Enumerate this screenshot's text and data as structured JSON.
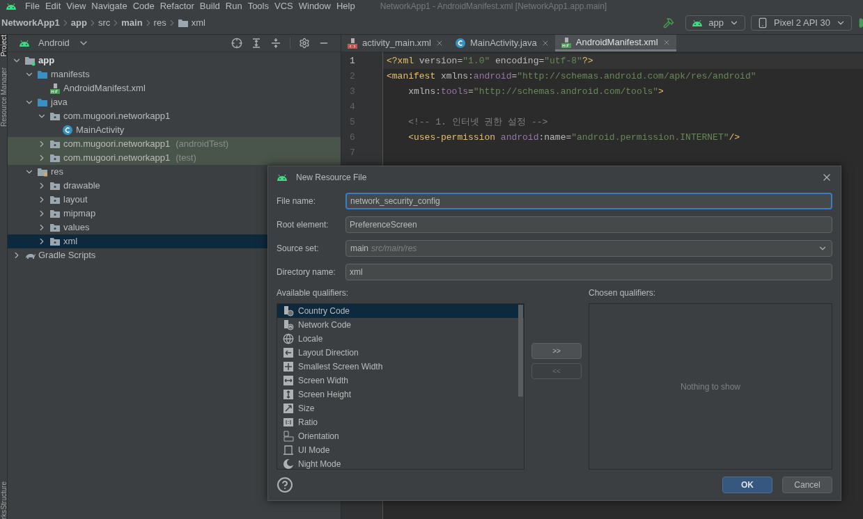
{
  "menu_bar": {
    "items": [
      "File",
      "Edit",
      "View",
      "Navigate",
      "Code",
      "Refactor",
      "Build",
      "Run",
      "Tools",
      "VCS",
      "Window",
      "Help"
    ],
    "title": "NetworkApp1 - AndroidManifest.xml [NetworkApp1.app.main]"
  },
  "breadcrumb": [
    {
      "label": "NetworkApp1",
      "bold": true
    },
    {
      "label": "app",
      "bold": true
    },
    {
      "label": "src",
      "bold": false
    },
    {
      "label": "main",
      "bold": true
    },
    {
      "label": "res",
      "bold": false
    },
    {
      "label": "xml",
      "bold": false,
      "folder": true
    }
  ],
  "run_toolbar": {
    "module": "app",
    "device": "Pixel 2 API 30"
  },
  "side_stripe": [
    {
      "label": "Project",
      "selected": true
    },
    {
      "label": "Resource Manager",
      "selected": false
    },
    {
      "label": "Structure",
      "selected": false
    },
    {
      "label": "rks",
      "selected": false
    }
  ],
  "project_panel": {
    "view": "Android",
    "tree": [
      {
        "label": "app",
        "kind": "module",
        "expanded": true,
        "children": [
          {
            "label": "manifests",
            "kind": "folder",
            "expanded": true,
            "children": [
              {
                "label": "AndroidManifest.xml",
                "kind": "manifest"
              }
            ]
          },
          {
            "label": "java",
            "kind": "folder",
            "expanded": true,
            "children": [
              {
                "label": "com.mugoori.networkapp1",
                "kind": "package",
                "expanded": true,
                "children": [
                  {
                    "label": "MainActivity",
                    "kind": "class"
                  }
                ]
              },
              {
                "label": "com.mugoori.networkapp1",
                "suffix": "(androidTest)",
                "kind": "package",
                "test": true,
                "expanded": false
              },
              {
                "label": "com.mugoori.networkapp1",
                "suffix": "(test)",
                "kind": "package",
                "test": true,
                "expanded": false
              }
            ]
          },
          {
            "label": "res",
            "kind": "resources",
            "expanded": true,
            "children": [
              {
                "label": "drawable",
                "kind": "package",
                "expanded": false
              },
              {
                "label": "layout",
                "kind": "package",
                "expanded": false
              },
              {
                "label": "mipmap",
                "kind": "package",
                "expanded": false
              },
              {
                "label": "values",
                "kind": "package",
                "expanded": false
              },
              {
                "label": "xml",
                "kind": "package",
                "expanded": false,
                "selected": true
              }
            ]
          }
        ]
      },
      {
        "label": "Gradle Scripts",
        "kind": "gradle",
        "expanded": false
      }
    ]
  },
  "editor_tabs": [
    {
      "label": "activity_main.xml",
      "kind": "layout",
      "selected": false
    },
    {
      "label": "MainActivity.java",
      "kind": "class",
      "selected": false
    },
    {
      "label": "AndroidManifest.xml",
      "kind": "manifest",
      "selected": true
    }
  ],
  "code_lines": [
    {
      "number": "1",
      "current": true,
      "segments": [
        {
          "kind": "tag",
          "text": "<?xml "
        },
        {
          "kind": "plain",
          "text": "version="
        },
        {
          "kind": "value",
          "text": "\"1.0\""
        },
        {
          "kind": "plain",
          "text": " encoding="
        },
        {
          "kind": "value",
          "text": "\"utf-8\""
        },
        {
          "kind": "tag",
          "text": "?>"
        }
      ]
    },
    {
      "number": "2",
      "current": false,
      "segments": [
        {
          "kind": "tag",
          "text": "<manifest "
        },
        {
          "kind": "plain",
          "text": "xmlns:"
        },
        {
          "kind": "ns",
          "text": "android"
        },
        {
          "kind": "plain",
          "text": "="
        },
        {
          "kind": "value",
          "text": "\"http://schemas.android.com/apk/res/android\""
        }
      ]
    },
    {
      "number": "3",
      "current": false,
      "segments": [
        {
          "kind": "plain",
          "text": "    xmlns:"
        },
        {
          "kind": "ns",
          "text": "tools"
        },
        {
          "kind": "plain",
          "text": "="
        },
        {
          "kind": "value",
          "text": "\"http://schemas.android.com/tools\""
        },
        {
          "kind": "tag",
          "text": ">"
        }
      ]
    },
    {
      "number": "4",
      "current": false
    },
    {
      "number": "5",
      "current": false,
      "segments": [
        {
          "kind": "comment",
          "text": "    <!-- 1. 인터넷 권한 설정 -->"
        }
      ]
    },
    {
      "number": "6",
      "current": false,
      "segments": [
        {
          "kind": "tag",
          "text": "    <uses-permission "
        },
        {
          "kind": "ns",
          "text": "android"
        },
        {
          "kind": "plain",
          "text": ":name="
        },
        {
          "kind": "value",
          "text": "\"android.permission.INTERNET\""
        },
        {
          "kind": "tag",
          "text": "/>"
        }
      ]
    },
    {
      "number": "7",
      "current": false
    }
  ],
  "dialog": {
    "title": "New Resource File",
    "fields": [
      {
        "label": "File name:",
        "kind": "text",
        "value": "network_security_config",
        "focused": true
      },
      {
        "label": "Root element:",
        "kind": "text",
        "value": "PreferenceScreen",
        "focused": false
      },
      {
        "label": "Source set:",
        "kind": "dropdown",
        "value": "main",
        "hint": "src/main/res",
        "focused": false
      },
      {
        "label": "Directory name:",
        "kind": "text",
        "value": "xml",
        "focused": false
      }
    ],
    "available_label": "Available qualifiers:",
    "qualifiers": [
      {
        "label": "Country Code",
        "kind": "country",
        "selected": true
      },
      {
        "label": "Network Code",
        "kind": "network",
        "selected": false
      },
      {
        "label": "Locale",
        "kind": "locale",
        "selected": false
      },
      {
        "label": "Layout Direction",
        "kind": "direction",
        "selected": false
      },
      {
        "label": "Smallest Screen Width",
        "kind": "smallest",
        "selected": false
      },
      {
        "label": "Screen Width",
        "kind": "width",
        "selected": false
      },
      {
        "label": "Screen Height",
        "kind": "height",
        "selected": false
      },
      {
        "label": "Size",
        "kind": "size",
        "selected": false
      },
      {
        "label": "Ratio",
        "kind": "ratio",
        "selected": false
      },
      {
        "label": "Orientation",
        "kind": "orientation",
        "selected": false
      },
      {
        "label": "UI Mode",
        "kind": "uimode",
        "selected": false
      },
      {
        "label": "Night Mode",
        "kind": "night",
        "selected": false
      }
    ],
    "move_buttons": [
      {
        "label": ">>",
        "disabled": false
      },
      {
        "label": "<<",
        "disabled": true
      }
    ],
    "chosen_label": "Chosen qualifiers:",
    "chosen_empty": "Nothing to show",
    "buttons": [
      {
        "label": "OK",
        "kind": "primary"
      },
      {
        "label": "Cancel",
        "kind": "secondary"
      }
    ]
  }
}
